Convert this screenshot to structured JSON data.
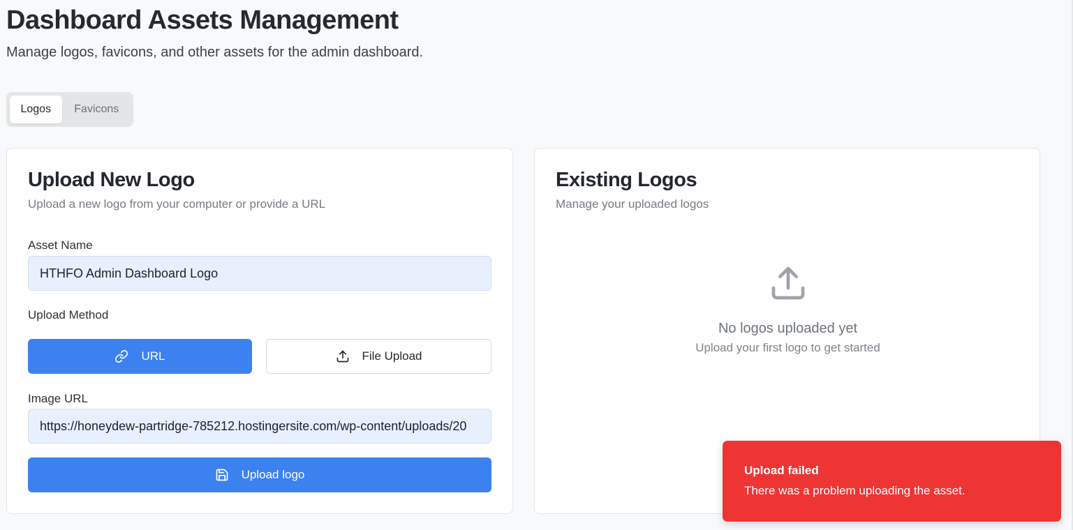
{
  "header": {
    "title": "Dashboard Assets Management",
    "subtitle": "Manage logos, favicons, and other assets for the admin dashboard."
  },
  "tabs": [
    {
      "label": "Logos",
      "active": true
    },
    {
      "label": "Favicons",
      "active": false
    }
  ],
  "upload_card": {
    "title": "Upload New Logo",
    "description": "Upload a new logo from your computer or provide a URL",
    "asset_name_label": "Asset Name",
    "asset_name_value": "HTHFO Admin Dashboard Logo",
    "upload_method_label": "Upload Method",
    "method_url_label": "URL",
    "method_file_label": "File Upload",
    "selected_method": "URL",
    "image_url_label": "Image URL",
    "image_url_value": "https://honeydew-partridge-785212.hostingersite.com/wp-content/uploads/20",
    "submit_label": "Upload logo"
  },
  "existing_card": {
    "title": "Existing Logos",
    "description": "Manage your uploaded logos",
    "empty_title": "No logos uploaded yet",
    "empty_subtitle": "Upload your first logo to get started"
  },
  "toast": {
    "title": "Upload failed",
    "message": "There was a problem uploading the asset.",
    "color": "#ef3434"
  },
  "icons": {
    "url_method": "link-icon",
    "file_method": "upload-icon",
    "submit": "save-icon",
    "empty_state": "upload-icon"
  },
  "colors": {
    "primary": "#3b82f0",
    "background": "#f8f9fb",
    "input_background": "#e8f0fe"
  }
}
